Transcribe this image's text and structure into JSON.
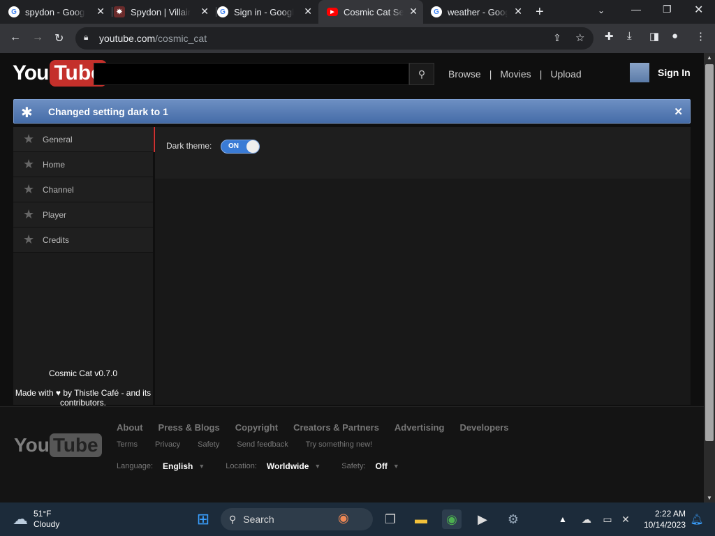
{
  "browser": {
    "tabs": [
      {
        "title": "spydon - Google",
        "icon": "google-icon"
      },
      {
        "title": "Spydon | Villain",
        "icon": "fandom-icon"
      },
      {
        "title": "Sign in - Google",
        "icon": "google-icon"
      },
      {
        "title": "Cosmic Cat Sett",
        "icon": "youtube-icon",
        "active": true
      },
      {
        "title": "weather - Goog",
        "icon": "google-icon"
      }
    ],
    "url_domain": "youtube.com",
    "url_path": "/cosmic_cat"
  },
  "header": {
    "logo_you": "You",
    "logo_tube": "Tube",
    "nav": [
      "Browse",
      "|",
      "Movies",
      "|",
      "Upload"
    ],
    "signin": "Sign In"
  },
  "notification": {
    "message": "Changed setting dark to 1"
  },
  "sidebar": {
    "items": [
      {
        "label": "General",
        "selected": true
      },
      {
        "label": "Home"
      },
      {
        "label": "Channel"
      },
      {
        "label": "Player"
      },
      {
        "label": "Credits"
      }
    ],
    "version": "Cosmic Cat v0.7.0",
    "made_with": "Made with ♥ by Thistle Café - and its contributors."
  },
  "settings": {
    "dark_theme_label": "Dark theme:",
    "dark_theme_state": "ON"
  },
  "footer": {
    "links_primary": [
      "About",
      "Press & Blogs",
      "Copyright",
      "Creators & Partners",
      "Advertising",
      "Developers"
    ],
    "links_secondary": [
      "Terms",
      "Privacy",
      "Safety",
      "Send feedback",
      "Try something new!"
    ],
    "language_label": "Language:",
    "language_value": "English",
    "location_label": "Location:",
    "location_value": "Worldwide",
    "safety_label": "Safety:",
    "safety_value": "Off"
  },
  "taskbar": {
    "temperature": "51°F",
    "condition": "Cloudy",
    "search_placeholder": "Search",
    "time": "2:22 AM",
    "date": "10/14/2023"
  },
  "colors": {
    "accent_blue": "#3a7bd5",
    "youtube_red": "#c4302b",
    "selected_bar": "#cc3333"
  }
}
